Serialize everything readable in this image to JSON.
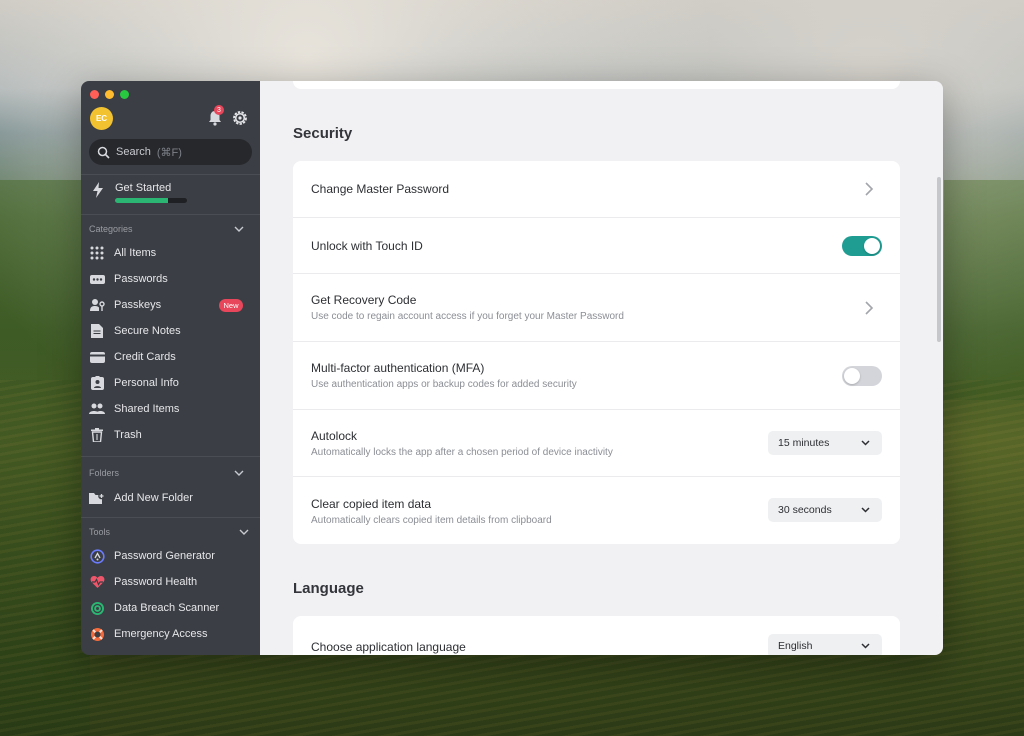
{
  "colors": {
    "sidebar_bg": "#3b3e44",
    "main_bg": "#f1f1f3",
    "accent_teal": "#1f9d93",
    "progress_green": "#2bb673",
    "badge_red": "#e8465a",
    "traffic_red": "#ff5f57",
    "traffic_yellow": "#febc2e",
    "traffic_green": "#28c840"
  },
  "sidebar": {
    "avatar_initials": "EC",
    "notification_count": "3",
    "search": {
      "label": "Search",
      "shortcut": "(⌘F)"
    },
    "get_started": {
      "label": "Get Started",
      "progress": 0.73
    },
    "categories": {
      "title": "Categories",
      "items": [
        {
          "label": "All Items",
          "icon": "grid-icon"
        },
        {
          "label": "Passwords",
          "icon": "password-icon"
        },
        {
          "label": "Passkeys",
          "icon": "passkey-icon",
          "tag": "New"
        },
        {
          "label": "Secure Notes",
          "icon": "note-icon"
        },
        {
          "label": "Credit Cards",
          "icon": "credit-card-icon"
        },
        {
          "label": "Personal Info",
          "icon": "id-card-icon"
        },
        {
          "label": "Shared Items",
          "icon": "shared-users-icon"
        },
        {
          "label": "Trash",
          "icon": "trash-icon"
        }
      ]
    },
    "folders": {
      "title": "Folders",
      "items": [
        {
          "label": "Add New Folder",
          "icon": "folder-add-icon"
        }
      ]
    },
    "tools": {
      "title": "Tools",
      "items": [
        {
          "label": "Password Generator",
          "icon": "password-generator-icon"
        },
        {
          "label": "Password Health",
          "icon": "heart-pulse-icon"
        },
        {
          "label": "Data Breach Scanner",
          "icon": "radar-icon"
        },
        {
          "label": "Emergency Access",
          "icon": "lifebuoy-icon"
        }
      ]
    }
  },
  "main": {
    "security": {
      "title": "Security",
      "rows": [
        {
          "title": "Change Master Password",
          "control": "chevron"
        },
        {
          "title": "Unlock with Touch ID",
          "control": "toggle",
          "enabled": true
        },
        {
          "title": "Get Recovery Code",
          "subtitle": "Use code to regain account access if you forget your Master Password",
          "control": "chevron"
        },
        {
          "title": "Multi-factor authentication (MFA)",
          "subtitle": "Use authentication apps or backup codes for added security",
          "control": "toggle",
          "enabled": false
        },
        {
          "title": "Autolock",
          "subtitle": "Automatically locks the app after a chosen period of device inactivity",
          "control": "select",
          "value": "15 minutes"
        },
        {
          "title": "Clear copied item data",
          "subtitle": "Automatically clears copied item details from clipboard",
          "control": "select",
          "value": "30 seconds"
        }
      ]
    },
    "language": {
      "title": "Language",
      "rows": [
        {
          "title": "Choose application language",
          "control": "select",
          "value": "English"
        }
      ]
    }
  }
}
